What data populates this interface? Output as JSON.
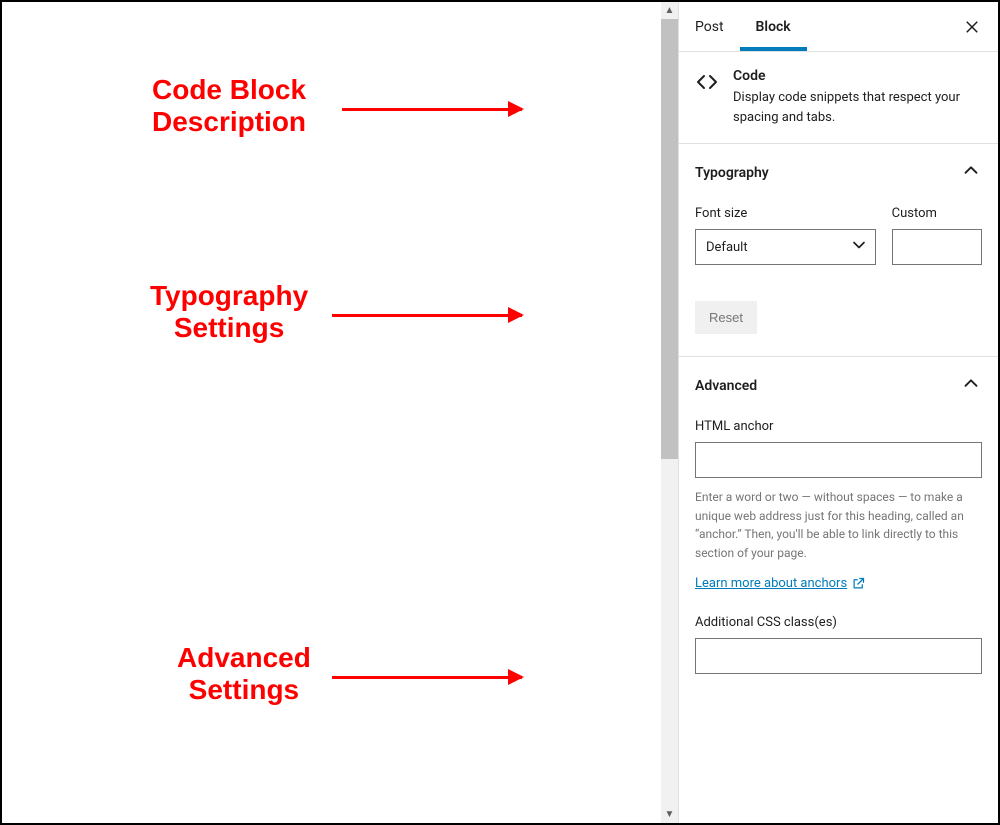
{
  "callouts": {
    "desc": "Code Block\nDescription",
    "typo": "Typography\nSettings",
    "adv": "Advanced\nSettings"
  },
  "tabs": {
    "post": "Post",
    "block": "Block"
  },
  "block": {
    "title": "Code",
    "description": "Display code snippets that respect your spacing and tabs."
  },
  "typography": {
    "title": "Typography",
    "fontSizeLabel": "Font size",
    "customLabel": "Custom",
    "selectValue": "Default",
    "resetLabel": "Reset"
  },
  "advanced": {
    "title": "Advanced",
    "anchorLabel": "HTML anchor",
    "anchorHelp": "Enter a word or two — without spaces — to make a unique web address just for this heading, called an “anchor.” Then, you'll be able to link directly to this section of your page.",
    "learnMore": "Learn more about anchors",
    "cssLabel": "Additional CSS class(es)"
  }
}
